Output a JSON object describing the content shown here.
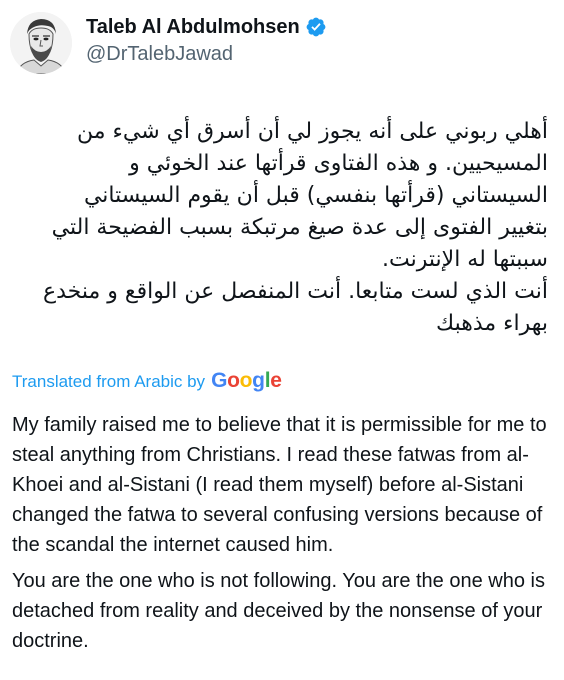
{
  "author": {
    "display_name": "Taleb Al Abdulmohsen",
    "handle": "@DrTalebJawad",
    "verified": true,
    "verified_color": "#1d9bf0"
  },
  "tweet": {
    "arabic_paragraphs": [
      "أهلي ربوني على أنه يجوز لي أن أسرق أي شيء من المسيحيين. و هذه الفتاوى قرأتها عند الخوئي و السيستاني (قرأتها بنفسي) قبل أن يقوم السيستاني بتغيير الفتوى إلى عدة صيغ مرتبكة بسبب الفضيحة التي سببتها له الإنترنت.",
      "أنت الذي لست متابعا. أنت المنفصل عن الواقع و منخدع بهراء مذهبك"
    ],
    "translation": {
      "label": "Translated from Arabic by",
      "provider": "Google",
      "paragraphs": [
        "My family raised me to believe that it is permissible for me to steal anything from Christians. I read these fatwas from al-Khoei and al-Sistani (I read them myself) before al-Sistani changed the fatwa to several confusing versions because of the scandal the internet caused him.",
        "You are the one who is not following. You are the one who is detached from reality and deceived by the nonsense of your doctrine."
      ]
    }
  },
  "colors": {
    "link": "#1d9bf0",
    "text": "#0f1419",
    "secondary": "#536471",
    "google_blue": "#4285F4",
    "google_red": "#EA4335",
    "google_yellow": "#FBBC05",
    "google_green": "#34A853"
  },
  "icons": {
    "avatar": "sketch-portrait-avatar",
    "verified": "verified-badge-icon"
  }
}
